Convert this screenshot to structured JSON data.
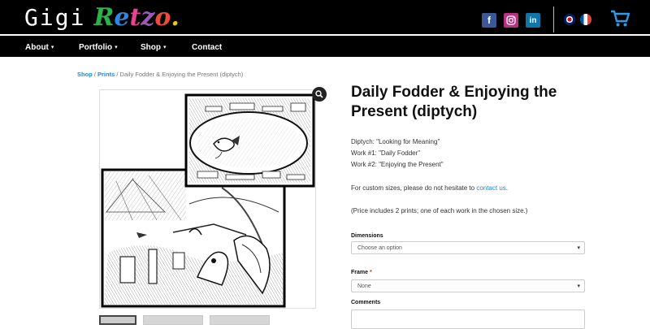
{
  "header": {
    "logo_first": "Gigi",
    "logo_last_letters": [
      "R",
      "e",
      "t",
      "z",
      "o",
      "."
    ],
    "logo_colors": [
      "#2bb34a",
      "#2e86de",
      "#e84393",
      "#9b59b6",
      "#e74c3c",
      "#f1c40f"
    ],
    "social_icons": [
      {
        "name": "facebook-icon",
        "glyph": "f"
      },
      {
        "name": "instagram-icon",
        "glyph": "◎"
      },
      {
        "name": "linkedin-icon",
        "glyph": "in"
      }
    ],
    "languages": [
      "uk-flag-icon",
      "france-flag-icon"
    ],
    "cart_icon": "shopping-cart-icon",
    "accent": "#1a8ad8"
  },
  "nav": {
    "about": "About",
    "portfolio": "Portfolio",
    "shop": "Shop",
    "contact": "Contact",
    "caret": "▾"
  },
  "breadcrumb": {
    "shop": "Shop",
    "sep1": " / ",
    "prints": "Prints",
    "sep2": " / ",
    "current": "Daily Fodder & Enjoying the Present (diptych)"
  },
  "product": {
    "title": "Daily Fodder & Enjoying the Present (diptych)",
    "diptych": "Diptych: \"Looking for Meaning\"",
    "work1": "Work #1: \"Daily Fodder\"",
    "work2": "Work #2: \"Enjoying the Present\"",
    "custom_prefix": "For custom sizes, please do not hesitate to ",
    "custom_link": "contact us",
    "custom_suffix": ".",
    "price_note": "(Price includes 2 prints; one of each work in the chosen size.)",
    "dimensions_label": "Dimensions",
    "dimensions_value": "Choose an option",
    "frame_label": "Frame",
    "frame_required": "*",
    "frame_value": "None",
    "comments_label": "Comments"
  },
  "gallery": {
    "zoom_icon": "magnifier-icon",
    "thumb_count": 3
  }
}
